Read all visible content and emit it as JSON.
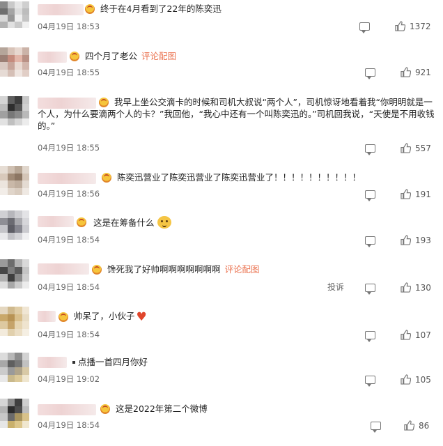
{
  "colors": {
    "accent": "#eb7350",
    "heart": "#e0452b"
  },
  "icons": {
    "comment": "comment-icon",
    "like": "thumb-up-icon",
    "badge": "fan-badge-icon"
  },
  "comments": [
    {
      "text": "终于在4月看到了22年的陈奕迅",
      "link": "",
      "time": "04月19日 18:53",
      "likes": "1372"
    },
    {
      "text": "四个月了老公",
      "link": "评论配图",
      "time": "04月19日 18:55",
      "likes": "921"
    },
    {
      "text": "我早上坐公交滴卡的时候和司机大叔说“两个人”，司机惊讶地看着我“你明明就是一个人，为什么要滴两个人的卡？”我回他，“我心中还有一个叫陈奕迅的。”司机回我说，“天使是不用收钱的。”",
      "link": "",
      "time": "04月19日 18:55",
      "likes": "557"
    },
    {
      "text": "陈奕迅营业了陈奕迅营业了陈奕迅营业了！！！！！！！！！！",
      "link": "",
      "time": "04月19日 18:56",
      "likes": "191"
    },
    {
      "text": "这是在筹备什么",
      "link": "",
      "time": "04月19日 18:54",
      "likes": "193"
    },
    {
      "text": "馋死我了好帅啊啊啊啊啊啊啊",
      "link": "评论配图",
      "time": "04月19日 18:54",
      "likes": "130",
      "report": "投诉"
    },
    {
      "text": "帅呆了，小伙子",
      "link": "",
      "time": "04月19日 18:54",
      "likes": "107"
    },
    {
      "text": "点播一首四月你好",
      "link": "",
      "time": "04月19日 19:02",
      "likes": "105"
    },
    {
      "text": "这是2022年第二个微博",
      "link": "",
      "time": "04月19日 18:54",
      "likes": "86"
    }
  ]
}
